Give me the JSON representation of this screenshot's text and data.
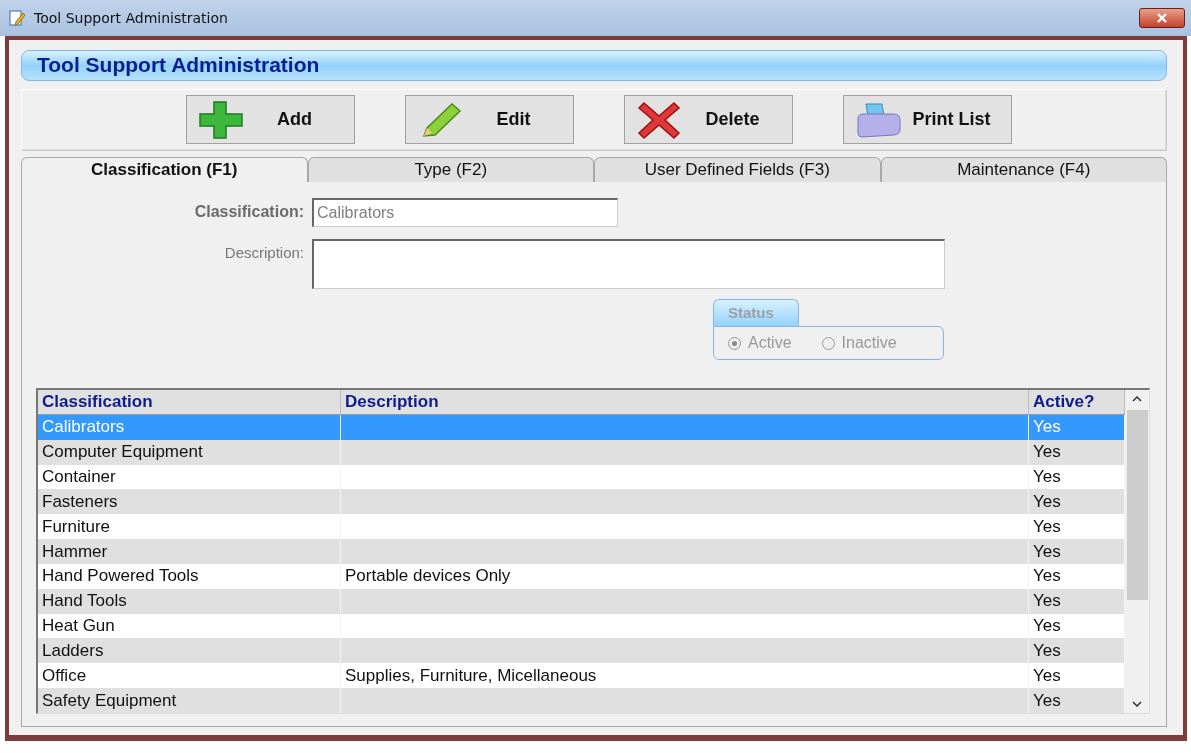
{
  "window": {
    "title": "Tool Support Administration"
  },
  "header": {
    "title": "Tool Support Administration"
  },
  "toolbar": {
    "buttons": [
      {
        "label": "Add",
        "kind": "add"
      },
      {
        "label": "Edit",
        "kind": "edit"
      },
      {
        "label": "Delete",
        "kind": "delete"
      },
      {
        "label": "Print List",
        "kind": "print"
      }
    ]
  },
  "tabs": [
    {
      "label": "Classification (F1)",
      "selected": true
    },
    {
      "label": "Type (F2)",
      "selected": false
    },
    {
      "label": "User Defined Fields (F3)",
      "selected": false
    },
    {
      "label": "Maintenance (F4)",
      "selected": false
    }
  ],
  "form": {
    "fields": [
      {
        "label": "Classification:",
        "value": "Calibrators",
        "kind": "text",
        "required": true,
        "disabled": true
      },
      {
        "label": "Description:",
        "kind": "textarea",
        "required": false
      }
    ],
    "status": {
      "title": "Status",
      "disabled": true,
      "options": [
        {
          "label": "Active",
          "selected": true
        },
        {
          "label": "Inactive",
          "selected": false
        }
      ]
    }
  },
  "table": {
    "columns": [
      "Classification",
      "Description",
      "Active?"
    ],
    "rows": [
      {
        "classification": "Calibrators",
        "active": "Yes",
        "selected": true
      },
      {
        "classification": "Computer Equipment",
        "active": "Yes",
        "selected": false
      },
      {
        "classification": "Container",
        "active": "Yes",
        "selected": false
      },
      {
        "classification": "Fasteners",
        "active": "Yes",
        "selected": false
      },
      {
        "classification": "Furniture",
        "active": "Yes",
        "selected": false
      },
      {
        "classification": "Hammer",
        "active": "Yes",
        "selected": false
      },
      {
        "classification": "Hand Powered Tools",
        "description": "Portable devices Only",
        "active": "Yes",
        "selected": false
      },
      {
        "classification": "Hand Tools",
        "active": "Yes",
        "selected": false
      },
      {
        "classification": "Heat Gun",
        "active": "Yes",
        "selected": false
      },
      {
        "classification": "Ladders",
        "active": "Yes",
        "selected": false
      },
      {
        "classification": "Office",
        "description": "Supplies, Furniture, Micellaneous",
        "active": "Yes",
        "selected": false
      },
      {
        "classification": "Safety Equipment",
        "active": "Yes",
        "selected": false
      }
    ]
  }
}
